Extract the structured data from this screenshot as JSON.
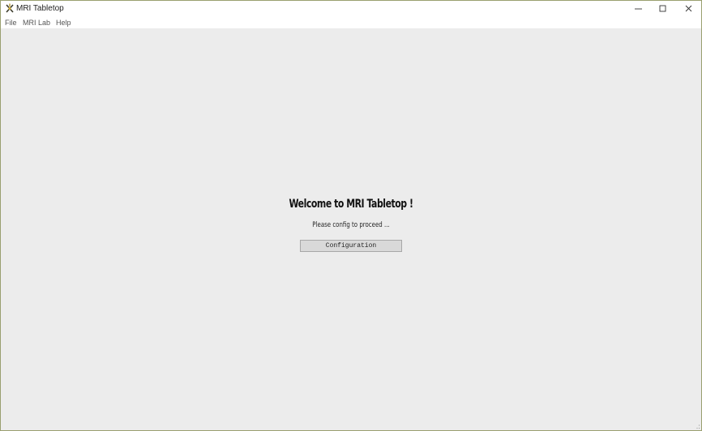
{
  "window": {
    "title": "MRI Tabletop",
    "icon": "crossed-tools-icon",
    "controls": [
      "minimize-icon",
      "maximize-icon",
      "close-icon"
    ]
  },
  "menubar": {
    "items": [
      "File",
      "MRI Lab",
      "Help"
    ]
  },
  "main": {
    "heading": "Welcome to MRI Tabletop !",
    "subheading": "Please config to proceed ...",
    "button_label": "Configuration"
  },
  "colors": {
    "background": "#ececec",
    "chrome": "#ffffff",
    "button": "#d9d9d9"
  }
}
